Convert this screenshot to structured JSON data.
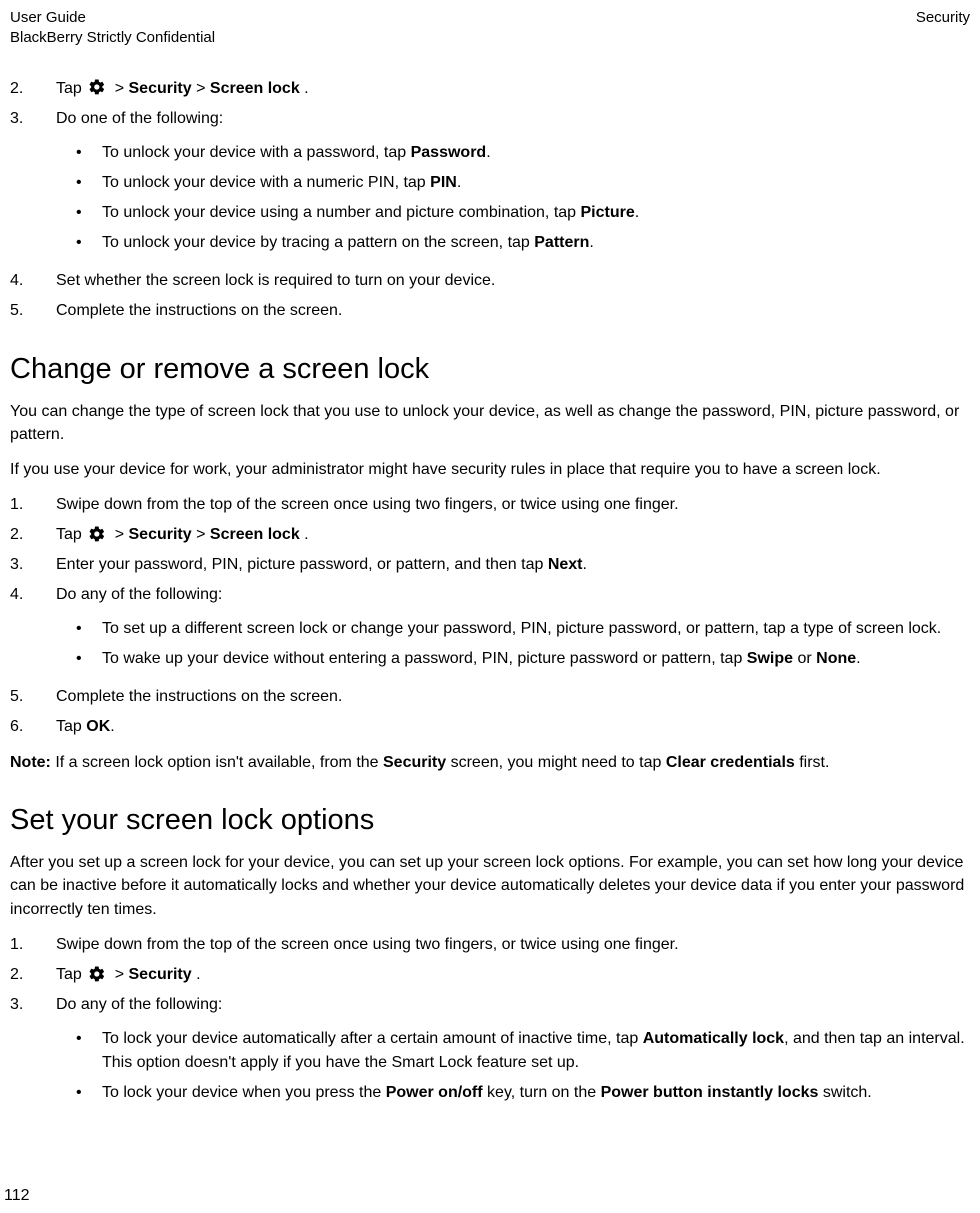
{
  "header": {
    "left1": "User Guide",
    "left2": "BlackBerry Strictly Confidential",
    "right": "Security"
  },
  "sections": {
    "s1": {
      "step2_tap": "Tap ",
      "step2_part1": " > ",
      "step2_bold1": "Security",
      "step2_part2": " > ",
      "step2_bold2": "Screen lock",
      "step2_end": ".",
      "step3": "Do one of the following:",
      "bullet1a": "To unlock your device with a password, tap ",
      "bullet1b": "Password",
      "bullet1c": ".",
      "bullet2a": "To unlock your device with a numeric PIN, tap ",
      "bullet2b": "PIN",
      "bullet2c": ".",
      "bullet3a": "To unlock your device using a number and picture combination, tap ",
      "bullet3b": "Picture",
      "bullet3c": ".",
      "bullet4a": "To unlock your device by tracing a pattern on the screen, tap ",
      "bullet4b": "Pattern",
      "bullet4c": ".",
      "step4": "Set whether the screen lock is required to turn on your device.",
      "step5": "Complete the instructions on the screen."
    },
    "s2": {
      "heading": "Change or remove a screen lock",
      "p1": "You can change the type of screen lock that you use to unlock your device, as well as change the password, PIN, picture password, or pattern.",
      "p2": "If you use your device for work, your administrator might have security rules in place that require you to have a screen lock.",
      "step1": "Swipe down from the top of the screen once using two fingers, or twice using one finger.",
      "step2_tap": "Tap ",
      "step2_part1": " > ",
      "step2_bold1": "Security",
      "step2_part2": " > ",
      "step2_bold2": "Screen lock",
      "step2_end": ".",
      "step3a": "Enter your password, PIN, picture password, or pattern, and then tap ",
      "step3b": "Next",
      "step3c": ".",
      "step4": "Do any of the following:",
      "bullet1": "To set up a different screen lock or change your password, PIN, picture password, or pattern, tap a type of screen lock.",
      "bullet2a": "To wake up your device without entering a password, PIN, picture password or pattern, tap ",
      "bullet2b": "Swipe",
      "bullet2c": " or ",
      "bullet2d": "None",
      "bullet2e": ".",
      "step5": "Complete the instructions on the screen.",
      "step6a": "Tap ",
      "step6b": "OK",
      "step6c": ".",
      "note_label": "Note:",
      "note_a": " If a screen lock option isn't available, from the ",
      "note_b": "Security",
      "note_c": " screen, you might need to tap ",
      "note_d": "Clear credentials",
      "note_e": " first."
    },
    "s3": {
      "heading": "Set your screen lock options",
      "p1": "After you set up a screen lock for your device, you can set up your screen lock options. For example, you can set how long your device can be inactive before it automatically locks and whether your device automatically deletes your device data if you enter your password incorrectly ten times.",
      "step1": "Swipe down from the top of the screen once using two fingers, or twice using one finger.",
      "step2_tap": "Tap ",
      "step2_part1": " > ",
      "step2_bold1": "Security",
      "step2_end": ".",
      "step3": "Do any of the following:",
      "bullet1a": "To lock your device automatically after a certain amount of inactive time, tap ",
      "bullet1b": "Automatically lock",
      "bullet1c": ", and then tap an interval. This option doesn't apply if you have the Smart Lock feature set up.",
      "bullet2a": "To lock your device when you press the ",
      "bullet2b": "Power on/off",
      "bullet2c": " key, turn on the ",
      "bullet2d": "Power button instantly locks",
      "bullet2e": " switch."
    }
  },
  "nums": {
    "n1": "1.",
    "n2": "2.",
    "n3": "3.",
    "n4": "4.",
    "n5": "5.",
    "n6": "6."
  },
  "page": "112"
}
